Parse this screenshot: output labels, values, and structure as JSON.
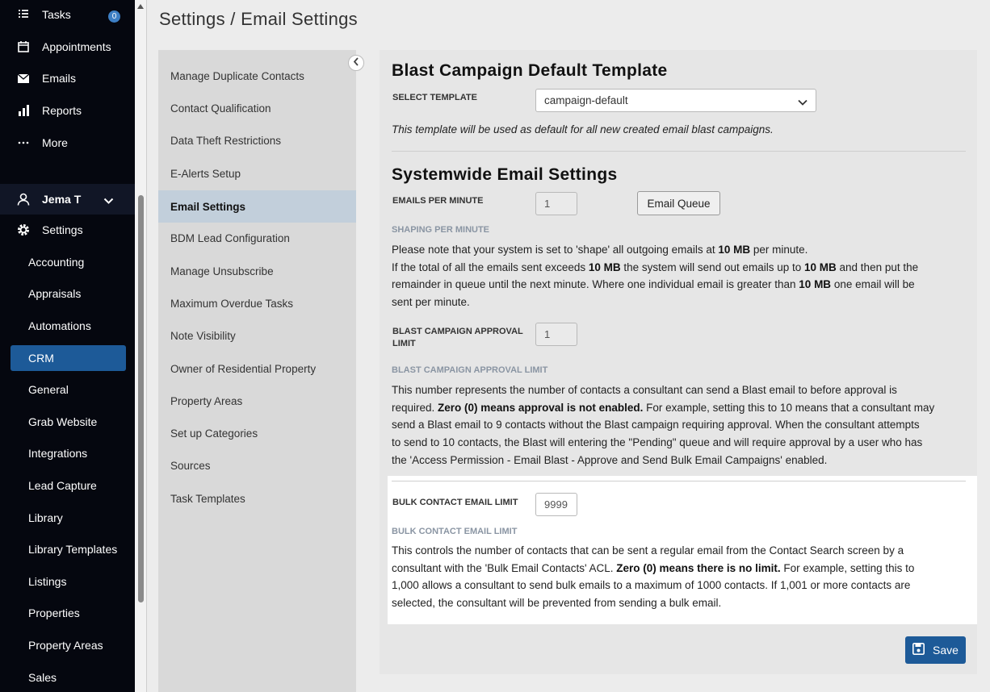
{
  "nav": {
    "top_items": [
      {
        "label": "Tasks",
        "icon": "tasks-icon",
        "badge": "0"
      },
      {
        "label": "Appointments",
        "icon": "calendar-icon"
      },
      {
        "label": "Emails",
        "icon": "envelope-icon"
      },
      {
        "label": "Reports",
        "icon": "bar-chart-icon"
      },
      {
        "label": "More",
        "icon": "ellipsis-icon"
      }
    ],
    "user": {
      "label": "Jema T",
      "icon": "user-icon"
    },
    "settings": {
      "label": "Settings",
      "icon": "gear-icon"
    },
    "sub_items": [
      "Accounting",
      "Appraisals",
      "Automations",
      "CRM",
      "General",
      "Grab Website",
      "Integrations",
      "Lead Capture",
      "Library",
      "Library Templates",
      "Listings",
      "Properties",
      "Property Areas",
      "Sales"
    ],
    "active_sub": "CRM"
  },
  "page_title": "Settings / Email Settings",
  "settings_list": {
    "items": [
      "Manage Duplicate Contacts",
      "Contact Qualification",
      "Data Theft Restrictions",
      "E-Alerts Setup",
      "Email Settings",
      "BDM Lead Configuration",
      "Manage Unsubscribe",
      "Maximum Overdue Tasks",
      "Note Visibility",
      "Owner of Residential Property",
      "Property Areas",
      "Set up Categories",
      "Sources",
      "Task Templates"
    ],
    "active": "Email Settings"
  },
  "blast_template": {
    "heading": "Blast Campaign Default Template",
    "select_label": "SELECT TEMPLATE",
    "select_value": "campaign-default",
    "note": "This template will be used as default for all new created email blast campaigns."
  },
  "systemwide": {
    "heading": "Systemwide Email Settings",
    "emails_per_minute_label": "EMAILS PER MINUTE",
    "emails_per_minute_value": "1",
    "email_queue_button": "Email Queue",
    "shaping_label": "SHAPING PER MINUTE",
    "shaping_lines": [
      [
        "Please note that your system is set to 'shape' all outgoing emails at ",
        "10 MB",
        " per minute."
      ],
      [
        "If the total of all the emails sent exceeds ",
        "10 MB",
        " the system will send out emails up to ",
        "10 MB",
        " and then put the"
      ],
      [
        "remainder in queue until the next minute. Where one individual email is greater than ",
        "10 MB",
        " one email will be"
      ],
      [
        "sent per minute."
      ]
    ],
    "approval_label_1": "BLAST CAMPAIGN APPROVAL",
    "approval_label_2": "LIMIT",
    "approval_value": "1",
    "approval_sublabel": "BLAST CAMPAIGN APPROVAL LIMIT",
    "approval_lines": [
      [
        "This number represents the number of contacts a consultant can send a Blast email to before approval is"
      ],
      [
        "required. ",
        "Zero (0) means approval is not enabled.",
        " For example, setting this to 10 means that a consultant may"
      ],
      [
        "send a Blast email to 9 contacts without the Blast campaign requiring approval. When the consultant attempts"
      ],
      [
        "to send to 10 contacts, the Blast will entering the \"Pending\" queue and will require approval by a user who has"
      ],
      [
        "the 'Access Permission - Email Blast - Approve and Send Bulk Email Campaigns' enabled."
      ]
    ],
    "bulk_label": "BULK CONTACT EMAIL LIMIT",
    "bulk_value": "9999",
    "bulk_sublabel": "BULK CONTACT EMAIL LIMIT",
    "bulk_lines": [
      [
        "This controls the number of contacts that can be sent a regular email from the Contact Search screen by a"
      ],
      [
        "consultant with the 'Bulk Email Contacts' ACL. ",
        "Zero (0) means there is no limit.",
        " For example, setting this to"
      ],
      [
        "1,000 allows a consultant to send bulk emails to a maximum of 1000 contacts. If 1,001 or more contacts are"
      ],
      [
        "selected, the consultant will be prevented from sending a bulk email."
      ]
    ]
  },
  "save_button": "Save"
}
